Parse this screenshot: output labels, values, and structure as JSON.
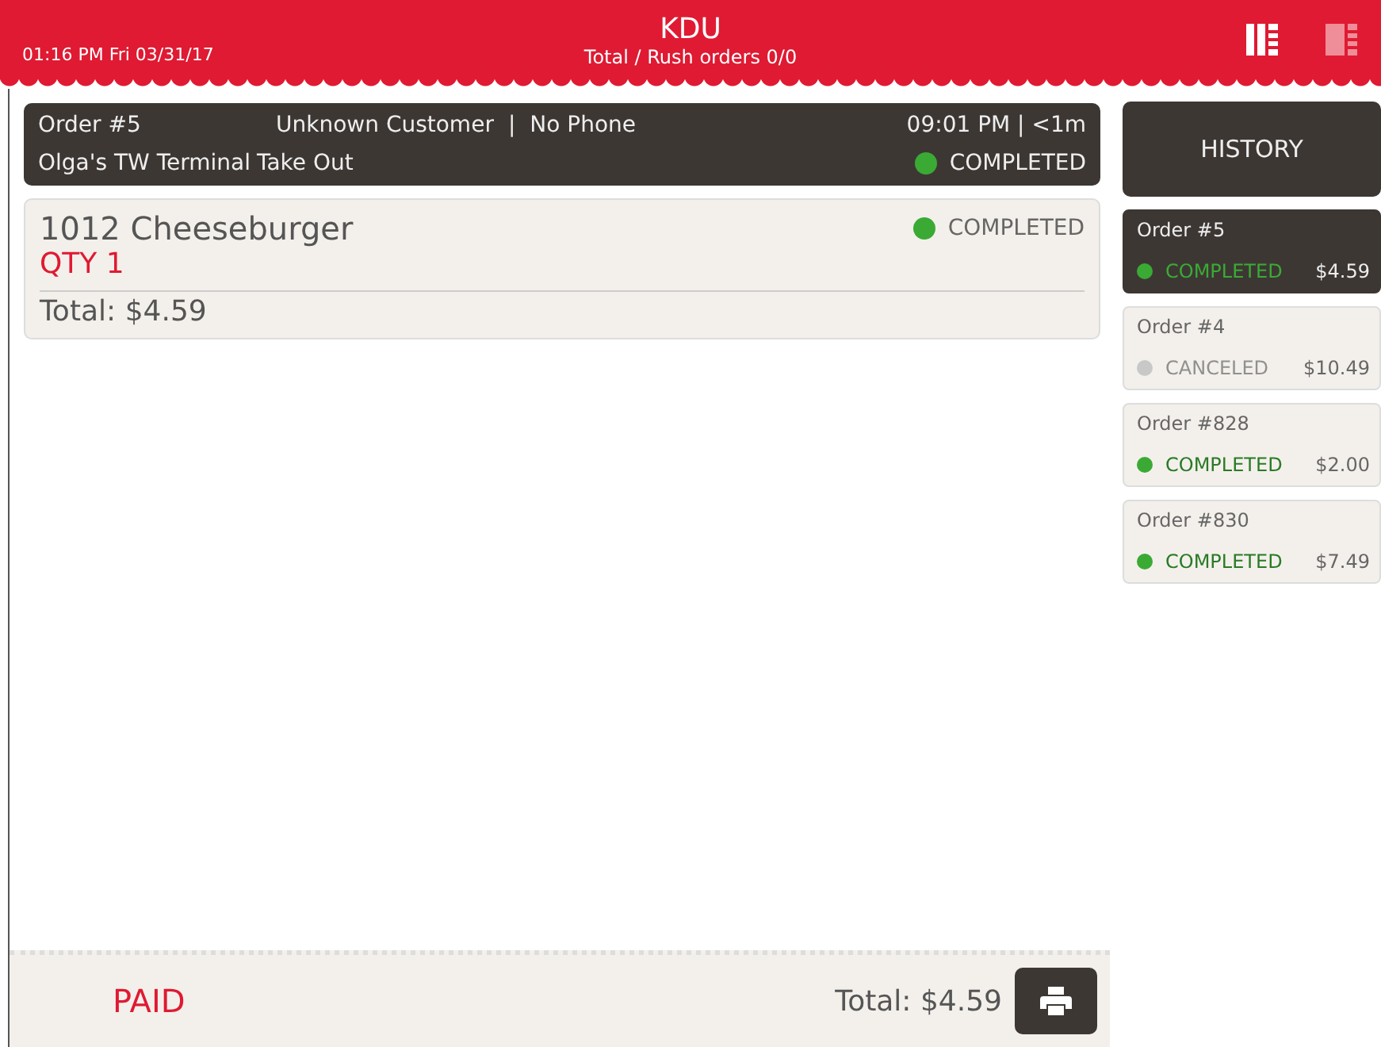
{
  "header": {
    "time": "01:16 PM Fri 03/31/17",
    "title": "KDU",
    "subtitle": "Total / Rush orders 0/0",
    "view_modes": [
      {
        "selected": true
      },
      {
        "selected": false
      }
    ]
  },
  "order": {
    "number": "Order #5",
    "customer": "Unknown Customer",
    "separator": "|",
    "phone": "No Phone",
    "time": "09:01 PM | <1m",
    "terminal": "Olga's TW Terminal",
    "type": "Take Out",
    "status": {
      "text": "COMPLETED",
      "color": "#3aaa35"
    },
    "items": [
      {
        "name": "1012 Cheeseburger",
        "qty": "QTY 1",
        "status": "COMPLETED",
        "color": "#3aaa35"
      }
    ],
    "total": "Total: $4.59"
  },
  "footer": {
    "payment": "PAID",
    "total": "Total: $4.59"
  },
  "history": {
    "button": "HISTORY",
    "orders": [
      {
        "number": "Order #5",
        "status": "COMPLETED",
        "amount": "$4.59",
        "color": "#3aaa35",
        "selected": true
      },
      {
        "number": "Order #4",
        "status": "CANCELED",
        "amount": "$10.49",
        "color": "#c8c8c8",
        "selected": false
      },
      {
        "number": "Order #828",
        "status": "COMPLETED",
        "amount": "$2.00",
        "color": "#3aaa35",
        "selected": false
      },
      {
        "number": "Order #830",
        "status": "COMPLETED",
        "amount": "$7.49",
        "color": "#3aaa35",
        "selected": false
      }
    ]
  }
}
